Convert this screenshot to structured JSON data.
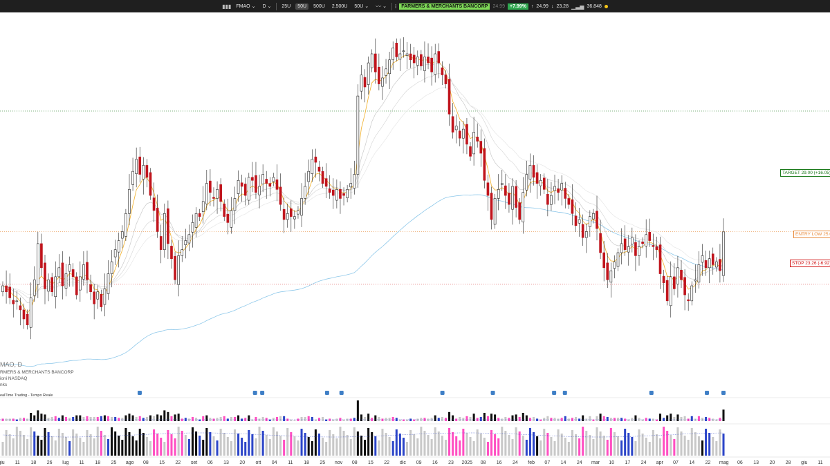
{
  "toolbar": {
    "symbol": "FMAO",
    "timeframe": "D",
    "views": [
      "25U",
      "50U",
      "500U",
      "2.500U",
      "50U"
    ],
    "active_view": "50U",
    "company": "FARMERS & MERCHANTS BANCORP",
    "last_price": "24.99",
    "change": "+7.99%",
    "high": "24.99",
    "low": "23.28",
    "volume": "36.848"
  },
  "info": {
    "symbol_line": "MAO, D",
    "company_line": "RMERS & MERCHANTS BANCORP",
    "exchange_line": "ioni NASDAQ",
    "sector_line": "nks",
    "feed_line": "ealTime Trading - Tempo Reale"
  },
  "levels": {
    "target_label": "TARGET 29.00 (+16.05)",
    "entry_label": "ENTRY LOW 25.0",
    "stop_label": "STOP 23.26 (-6.92)"
  },
  "colors": {
    "up_candle": "#ffffff",
    "down_candle": "#c0141c",
    "ma_fast": "#f2b63a",
    "ma_200": "#8ec8ea",
    "target": "#1a7a1a",
    "entry": "#e88a3a",
    "stop": "#d01010",
    "volume_magenta": "#ff4fc2",
    "volume_blue": "#2c45c8"
  },
  "chart_data": {
    "type": "candlestick",
    "title": "FMAO, D",
    "x_tick_labels": [
      "giu",
      "11",
      "18",
      "26",
      "lug",
      "11",
      "18",
      "25",
      "ago",
      "08",
      "15",
      "22",
      "set",
      "06",
      "13",
      "20",
      "ott",
      "04",
      "11",
      "18",
      "25",
      "nov",
      "08",
      "15",
      "22",
      "dic",
      "09",
      "16",
      "23",
      "2025",
      "08",
      "16",
      "24",
      "feb",
      "07",
      "14",
      "24",
      "mar",
      "10",
      "17",
      "24",
      "apr",
      "07",
      "14",
      "22",
      "mag",
      "06",
      "13",
      "20",
      "28",
      "giu",
      "11"
    ],
    "y_range": [
      21.0,
      32.0
    ],
    "close": [
      23.2,
      23.0,
      22.8,
      22.6,
      22.7,
      22.4,
      22.1,
      21.9,
      22.8,
      23.4,
      24.6,
      23.8,
      23.1,
      23.4,
      23.0,
      23.5,
      23.8,
      23.2,
      23.6,
      23.9,
      23.5,
      22.9,
      23.5,
      23.9,
      23.4,
      23.0,
      22.6,
      23.0,
      22.5,
      23.1,
      23.6,
      24.0,
      24.4,
      24.7,
      25.0,
      25.6,
      26.4,
      27.0,
      27.4,
      26.9,
      27.2,
      26.8,
      26.2,
      25.7,
      25.0,
      24.4,
      25.6,
      24.6,
      24.1,
      23.4,
      24.2,
      24.4,
      24.7,
      24.9,
      25.3,
      25.6,
      25.5,
      26.0,
      26.6,
      26.3,
      26.1,
      26.4,
      26.0,
      25.5,
      25.3,
      25.7,
      26.1,
      26.7,
      26.5,
      26.2,
      26.8,
      26.7,
      26.3,
      26.5,
      26.9,
      26.6,
      26.5,
      26.8,
      26.4,
      25.9,
      25.4,
      25.6,
      25.5,
      25.5,
      25.7,
      26.1,
      26.5,
      27.0,
      27.4,
      27.3,
      27.0,
      26.6,
      26.5,
      26.3,
      26.2,
      26.4,
      26.1,
      26.2,
      26.4,
      26.6,
      26.9,
      29.5,
      30.2,
      29.8,
      30.6,
      30.9,
      30.3,
      29.9,
      30.1,
      30.4,
      30.7,
      31.1,
      30.8,
      30.9,
      31.0,
      30.9,
      30.7,
      30.6,
      30.8,
      30.5,
      30.8,
      30.6,
      30.3,
      30.9,
      30.6,
      30.2,
      29.9,
      28.9,
      28.3,
      28.5,
      28.1,
      28.4,
      27.9,
      27.5,
      28.3,
      28.0,
      27.6,
      26.7,
      26.2,
      25.4,
      26.1,
      26.4,
      26.6,
      26.2,
      25.9,
      26.5,
      25.8,
      25.4,
      26.3,
      26.9,
      27.2,
      26.8,
      26.6,
      26.7,
      26.4,
      25.9,
      26.2,
      26.5,
      26.3,
      26.6,
      26.1,
      25.9,
      25.6,
      25.2,
      25.4,
      24.8,
      25.0,
      25.5,
      25.6,
      25.1,
      24.3,
      23.8,
      23.4,
      23.7,
      24.0,
      24.3,
      24.6,
      24.4,
      24.5,
      24.8,
      24.2,
      24.5,
      24.6,
      24.9,
      24.7,
      24.5,
      24.4,
      23.6,
      23.3,
      22.7,
      23.5,
      23.1,
      23.8,
      23.4,
      22.9,
      22.7,
      23.2,
      23.4,
      23.9,
      24.2,
      23.8,
      24.1,
      23.9,
      24.0,
      23.7,
      24.99
    ],
    "series": [
      {
        "name": "",
        "type": "ma_fast"
      },
      {
        "name": "",
        "type": "ma_mid"
      },
      {
        "name": "",
        "type": "ma_slow"
      },
      {
        "name": "",
        "type": "ma_200"
      }
    ],
    "levels": {
      "target": 29.0,
      "entry": 25.0,
      "stop": 23.26
    },
    "grid": false
  }
}
